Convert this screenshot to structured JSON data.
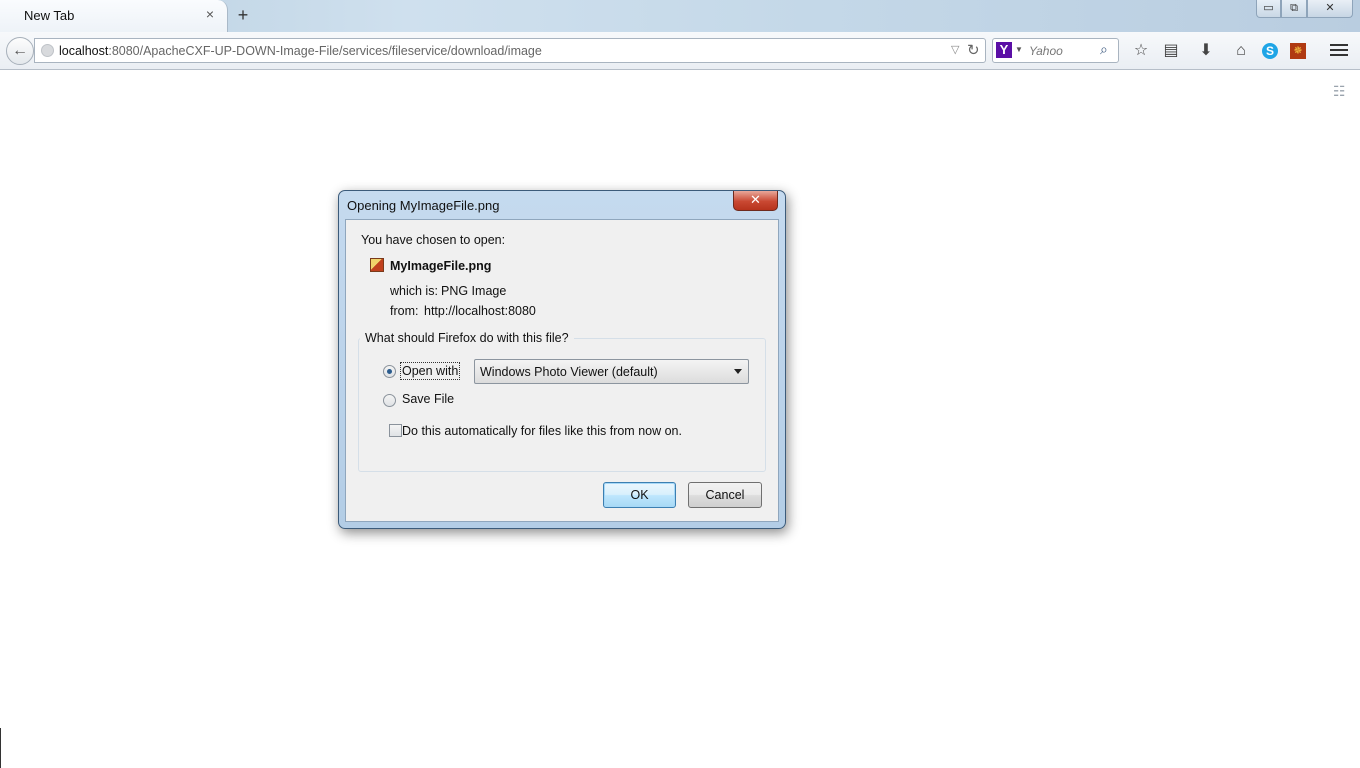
{
  "browser": {
    "tab_title": "New Tab",
    "tab_close": "×",
    "new_tab": "+",
    "window_controls": {
      "minimize": "▭",
      "maximize": "⧉",
      "close": "✕"
    }
  },
  "navbar": {
    "url_host": "localhost",
    "url_rest": ":8080/ApacheCXF-UP-DOWN-Image-File/services/fileservice/download/image",
    "search_engine_logo": "Y",
    "search_placeholder": "Yahoo",
    "icons": [
      "back-icon",
      "site-identity-icon",
      "history-dropdown-icon",
      "reload-icon",
      "yahoo-icon",
      "search-icon",
      "bookmark-star-icon",
      "reading-list-icon",
      "download-icon",
      "home-icon",
      "skype-icon",
      "extension-icon",
      "menu-icon"
    ]
  },
  "dialog": {
    "title": "Opening MyImageFile.png",
    "close_glyph": "✕",
    "intro": "You have chosen to open:",
    "file_name": "MyImageFile.png",
    "which_is_label": "which is:",
    "which_is_value": "PNG Image",
    "from_label": "from:",
    "from_value": "http://localhost:8080",
    "question": "What should Firefox do with this file?",
    "open_with_label": "Open with",
    "open_with_selected": "Windows Photo Viewer (default)",
    "open_with_checked": true,
    "save_file_label": "Save File",
    "save_file_checked": false,
    "auto_label": "Do this automatically for files like this from now on.",
    "auto_checked": false,
    "ok_label": "OK",
    "cancel_label": "Cancel"
  }
}
